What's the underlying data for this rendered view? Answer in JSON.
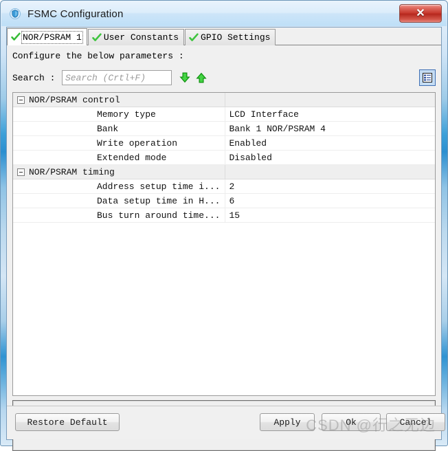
{
  "window": {
    "title": "FSMC Configuration",
    "app_icon": "shield-icon",
    "close_label": "✕"
  },
  "tabs": [
    {
      "label": "NOR/PSRAM 1",
      "icon": "green-check-icon",
      "active": true
    },
    {
      "label": "User Constants",
      "icon": "green-check-icon",
      "active": false
    },
    {
      "label": "GPIO Settings",
      "icon": "green-check-icon",
      "active": false
    }
  ],
  "main": {
    "instruction": "Configure the below parameters :",
    "search": {
      "label": "Search :",
      "value": "",
      "placeholder": "Search (Crtl+F)",
      "next_icon": "arrow-down-icon",
      "prev_icon": "arrow-up-icon"
    },
    "view_toggle": {
      "icon": "list-view-icon"
    }
  },
  "table": {
    "groups": [
      {
        "title": "NOR/PSRAM control",
        "expanded": true,
        "rows": [
          {
            "name": "Memory type",
            "value": "LCD Interface"
          },
          {
            "name": "Bank",
            "value": "Bank 1 NOR/PSRAM 4"
          },
          {
            "name": "Write operation",
            "value": "Enabled"
          },
          {
            "name": "Extended mode",
            "value": "Disabled"
          }
        ]
      },
      {
        "title": "NOR/PSRAM timing",
        "expanded": true,
        "rows": [
          {
            "name": "Address setup time i...",
            "value": "2"
          },
          {
            "name": "Data setup time in H...",
            "value": "6"
          },
          {
            "name": "Bus turn around time...",
            "value": "15"
          }
        ]
      }
    ]
  },
  "buttons": {
    "restore_default": "Restore Default",
    "apply": "Apply",
    "ok": "Ok",
    "cancel": "Cancel"
  },
  "watermark": "CSDN @行之无边",
  "colors": {
    "accent_blue": "#2b8fd0",
    "close_red": "#c5352a",
    "check_green": "#3ec43e",
    "arrow_green": "#22c522",
    "group_row_bg": "#efefef",
    "panel_bg": "#f0f0f0"
  }
}
